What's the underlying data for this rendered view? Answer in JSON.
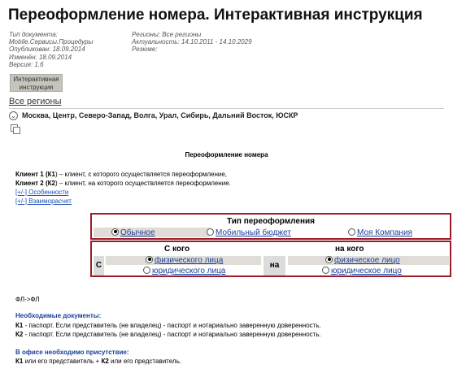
{
  "page": {
    "title": "Переоформление номера. Интерактивная инструкция"
  },
  "meta": {
    "doc_type_label": "Тип документа:",
    "doc_type_value": "Mobile.Сервисы.Процедуры",
    "published": "Опубликован: 18.09.2014",
    "changed": "Изменён: 18.09.2014",
    "version": "Версия: 1.6",
    "regions": "Регионы:  Все регионы",
    "actuality": "Актуальность:  14.10.2011 - 14.10.2029",
    "resume": "Резюме:"
  },
  "tag_button": {
    "line1": "Интерактивная",
    "line2": "инструкция"
  },
  "regions_link": "Все регионы",
  "regions_list": "Москва, Центр, Северо-Запад, Волга, Урал, Сибирь, Дальний Восток, ЮСКР",
  "content": {
    "subtitle": "Переоформление номера",
    "client1_a": "Клиент 1 (",
    "client1_b": "К1",
    "client1_c": ") – клиент, с которого осуществляется переоформление,",
    "client2_a": "Клиент 2 (",
    "client2_b": "К2",
    "client2_c": ") – клиент, на которого осуществляется переоформление.",
    "expander1": "[+/-] Особенности",
    "expander2": "[+/-] Взаиморасчет"
  },
  "reissue_type": {
    "heading": "Тип переоформления",
    "options": [
      "Обычное",
      "Мобильный бюджет",
      "Моя Компания"
    ],
    "selected": "Обычное"
  },
  "from_to": {
    "from_head": "С кого",
    "to_head": "на кого",
    "from_prefix": "С",
    "to_prefix": "на",
    "from_options": [
      "физического лица",
      "юридического лица"
    ],
    "to_options": [
      "физическое лицо",
      "юридическое лицо"
    ],
    "from_selected": "физического лица",
    "to_selected": "физическое лицо"
  },
  "result": {
    "formula": "ФЛ->ФЛ",
    "docs_title": "Необходимые документы:",
    "doc1_key": "К1",
    "doc1_text": " - паспорт. Если представитель (не владелец) - паспорт и нотариально заверенную доверенность.",
    "doc2_key": "К2",
    "doc2_text": " - паспорт. Если представитель (не владелец) - паспорт и нотариально заверенную доверенность.",
    "presence_title": "В офисе необходимо присутствие:",
    "presence_k1": "К1",
    "presence_mid": " или его представитель + ",
    "presence_k2": "К2",
    "presence_end": " или его представитель."
  },
  "colors": {
    "box_border": "#9b1c2a",
    "link": "#1a3f9a",
    "section_title": "#1a3f9a"
  }
}
